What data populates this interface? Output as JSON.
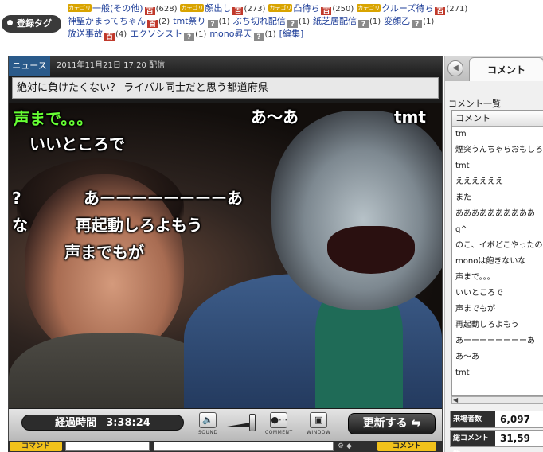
{
  "tags": {
    "label": "登録タグ",
    "cat_badge": "カテゴリ",
    "lines": [
      [
        {
          "cat": true,
          "name": "一般(その他)",
          "dic": "red",
          "dic_label": "百",
          "count": "(628)"
        },
        {
          "cat": true,
          "name": "顔出し",
          "dic": "red",
          "dic_label": "百",
          "count": "(273)"
        },
        {
          "cat": true,
          "name": "凸待ち",
          "dic": "red",
          "dic_label": "百",
          "count": "(250)"
        },
        {
          "cat": true,
          "name": "クルーズ待ち",
          "dic": "red",
          "dic_label": "百",
          "count": "(271)"
        }
      ],
      [
        {
          "cat": false,
          "name": "神聖かまってちゃん",
          "dic": "red",
          "dic_label": "百",
          "count": "(2)"
        },
        {
          "cat": false,
          "name": "tmt祭り",
          "dic": "gray",
          "dic_label": "?",
          "count": "(1)"
        },
        {
          "cat": false,
          "name": "ぶち切れ配信",
          "dic": "gray",
          "dic_label": "?",
          "count": "(1)"
        },
        {
          "cat": false,
          "name": "紙芝居配信",
          "dic": "gray",
          "dic_label": "?",
          "count": "(1)"
        },
        {
          "cat": false,
          "name": "変顔乙",
          "dic": "gray",
          "dic_label": "?",
          "count": "(1)"
        }
      ],
      [
        {
          "cat": false,
          "name": "放送事故",
          "dic": "red",
          "dic_label": "百",
          "count": "(4)"
        },
        {
          "cat": false,
          "name": "エクソシスト",
          "dic": "gray",
          "dic_label": "?",
          "count": "(1)"
        },
        {
          "cat": false,
          "name": "mono昇天",
          "dic": "gray",
          "dic_label": "?",
          "count": "(1)"
        }
      ]
    ],
    "edit_label": "[編集]"
  },
  "player": {
    "news_tab": "ニュース",
    "date_text": "2011年11月21日 17:20 配信",
    "title": "絶対に負けたくない？ ライバル同士だと思う都道府県",
    "overlay_comments": [
      {
        "text": "声まで。。。",
        "green": true
      },
      {
        "text": "あ～あ",
        "green": false
      },
      {
        "text": "tmt",
        "green": false
      },
      {
        "text": "いいところで",
        "green": false
      },
      {
        "text": "?",
        "green": false
      },
      {
        "text": "あーーーーーーーーあ",
        "green": false
      },
      {
        "text": "な",
        "green": false
      },
      {
        "text": "再起動しろよもう",
        "green": false
      },
      {
        "text": "声までもが",
        "green": false
      }
    ],
    "elapsed_label": "経過時間",
    "elapsed_time": "3:38:24",
    "sound_label": "SOUND",
    "comment_label": "COMMENT",
    "window_label": "WINDOW",
    "refresh_label": "更新する",
    "command_label": "コマンド",
    "send_label": "コメント"
  },
  "side": {
    "tab_label": "コメント",
    "list_title": "コメント一覧",
    "column_header": "コメント",
    "comments": [
      "tm",
      "煙突うんちゃらおもしろ",
      "tmt",
      "ええええええ",
      "また",
      "ああああああああああ",
      "q^",
      "のこ、イボどこやったの",
      "monoは飽きないな",
      "声まで。。。",
      "いいところで",
      "声までもが",
      "再起動しろよもう",
      "あーーーーーーーーあ",
      "あ～あ",
      "tmt"
    ],
    "visitors_label": "来場者数",
    "visitors_value": "6,097",
    "total_comments_label": "総コメント数",
    "total_comments_value": "31,59"
  }
}
